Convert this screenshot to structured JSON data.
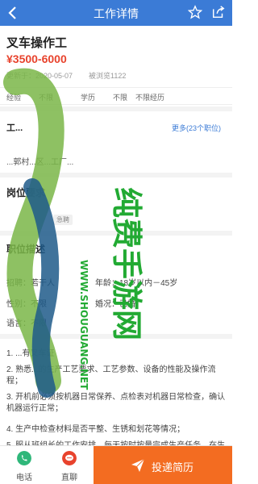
{
  "topbar": {
    "title": "工作详情",
    "back_icon": "back-arrow-icon",
    "star_icon": "star-icon",
    "share_icon": "share-icon",
    "bg": "#3b7bd6"
  },
  "job": {
    "title": "叉车操作工",
    "salary": "¥3500-6000",
    "update_label": "更新于：2020-05-07",
    "viewed_label": "被浏览1122"
  },
  "tags": [
    "经验",
    "不限",
    "学历",
    "不限",
    "不限经历"
  ],
  "company": {
    "name": "工...",
    "link": "更多(23个职位)",
    "address": "...郭村...区...工厂..."
  },
  "sections": {
    "requirements": "岗位要求",
    "description": "职位描述",
    "badge": "急聘"
  },
  "requirements": {
    "row1_left": "招聘：若干人",
    "row1_right": "年龄：18岁以内－45岁",
    "row2_left": "性别：不限",
    "row2_right": "婚况：已婚",
    "row3": "语言：不限"
  },
  "description_lines": [
    "1. ...有叉车证",
    "2. 熟悉...的生产工艺要求、工艺参数、设备的性能及操作流程；",
    "3. 开机前必须按机器日常保养、点检表对机器日常检查，确认机器运行正常；",
    "4. 生产中检查材料是否平整、生锈和划花等情况；",
    "5. 服从班组长的工作安排，每天按时按量完成生产任务，在生产..."
  ],
  "bottom": {
    "phone_label": "电话",
    "phone_icon": "phone-icon",
    "chat_label": "直聊",
    "chat_icon": "chat-icon",
    "apply_label": "投递简历",
    "apply_icon": "paper-plane-icon",
    "apply_color": "#f36c21"
  },
  "watermark": {
    "main_text": "纯费手游网",
    "url_text": "WWW.SHOUGUANG.NET",
    "color": "#22aa33"
  }
}
